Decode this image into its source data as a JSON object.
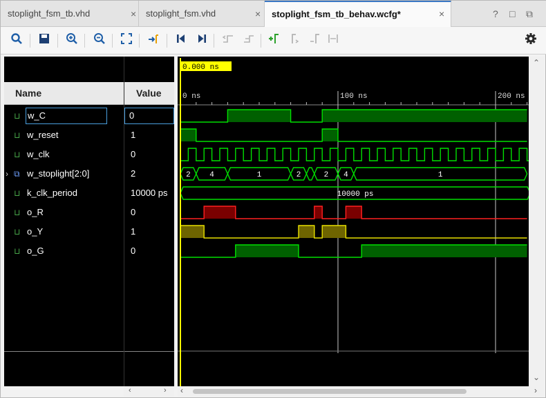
{
  "tabs": [
    {
      "label": "stoplight_fsm_tb.vhd",
      "active": false
    },
    {
      "label": "stoplight_fsm.vhd",
      "active": false
    },
    {
      "label": "stoplight_fsm_tb_behav.wcfg*",
      "active": true
    }
  ],
  "window_controls": {
    "help": "?",
    "maximize": "□",
    "restore": "⧉"
  },
  "toolbar": {
    "icons": [
      "search-icon",
      "save-icon",
      "zoom-in-icon",
      "zoom-out-icon",
      "zoom-fit-icon",
      "go-to-cursor-icon",
      "go-to-start-icon",
      "go-to-end-icon",
      "previous-transition-icon",
      "next-transition-icon",
      "add-marker-icon",
      "previous-marker-icon",
      "next-marker-icon",
      "swap-cursors-icon",
      "settings-icon"
    ]
  },
  "columns": {
    "name": "Name",
    "value": "Value"
  },
  "signals": [
    {
      "name": "w_C",
      "value": "0",
      "icon": "logic-signal-icon",
      "selected": true
    },
    {
      "name": "w_reset",
      "value": "1",
      "icon": "logic-signal-icon"
    },
    {
      "name": "w_clk",
      "value": "0",
      "icon": "logic-signal-icon"
    },
    {
      "name": "w_stoplight[2:0]",
      "value": "2",
      "icon": "bus-signal-icon",
      "expandable": true
    },
    {
      "name": "k_clk_period",
      "value": "10000 ps",
      "icon": "constant-icon"
    },
    {
      "name": "o_R",
      "value": "0",
      "icon": "output-signal-icon"
    },
    {
      "name": "o_Y",
      "value": "1",
      "icon": "output-signal-icon"
    },
    {
      "name": "o_G",
      "value": "0",
      "icon": "output-signal-icon"
    }
  ],
  "cursor": {
    "label": "0.000 ns",
    "time_ns": 0
  },
  "time_axis": {
    "unit": "ns",
    "labels": [
      "0 ns",
      "100 ns",
      "200 ns"
    ],
    "ticks_ns": [
      0,
      100,
      200
    ]
  },
  "waves": {
    "w_C": [
      [
        0,
        0
      ],
      [
        30,
        1
      ],
      [
        70,
        0
      ],
      [
        90,
        1
      ],
      [
        220,
        1
      ]
    ],
    "w_reset": [
      [
        0,
        1
      ],
      [
        10,
        0
      ],
      [
        90,
        1
      ],
      [
        100,
        0
      ],
      [
        220,
        0
      ]
    ],
    "w_stoplight_segments": [
      {
        "from": 0,
        "to": 10,
        "label": "2"
      },
      {
        "from": 10,
        "to": 30,
        "label": "4"
      },
      {
        "from": 30,
        "to": 70,
        "label": "1"
      },
      {
        "from": 70,
        "to": 80,
        "label": "2"
      },
      {
        "from": 80,
        "to": 85,
        "label": ""
      },
      {
        "from": 85,
        "to": 100,
        "label": "2"
      },
      {
        "from": 100,
        "to": 110,
        "label": "4"
      },
      {
        "from": 110,
        "to": 220,
        "label": "1"
      }
    ],
    "k_clk_period": "10000 ps",
    "o_R": [
      [
        0,
        0
      ],
      [
        15,
        1
      ],
      [
        35,
        0
      ],
      [
        85,
        1
      ],
      [
        90,
        0
      ],
      [
        105,
        1
      ],
      [
        115,
        0
      ],
      [
        220,
        0
      ]
    ],
    "o_Y": [
      [
        0,
        1
      ],
      [
        15,
        0
      ],
      [
        75,
        1
      ],
      [
        85,
        0
      ],
      [
        90,
        1
      ],
      [
        105,
        0
      ],
      [
        220,
        0
      ]
    ],
    "o_G": [
      [
        0,
        0
      ],
      [
        35,
        1
      ],
      [
        75,
        0
      ],
      [
        115,
        1
      ],
      [
        220,
        1
      ]
    ]
  },
  "colors": {
    "wave_green": "#00e000",
    "fill_green": "#006000",
    "wave_red": "#ff2020",
    "fill_red": "#7a0000",
    "wave_yellow": "#e8e000",
    "fill_yellow": "#6e6400",
    "cursor": "#ffff00",
    "marker": "#c8c8c8"
  }
}
